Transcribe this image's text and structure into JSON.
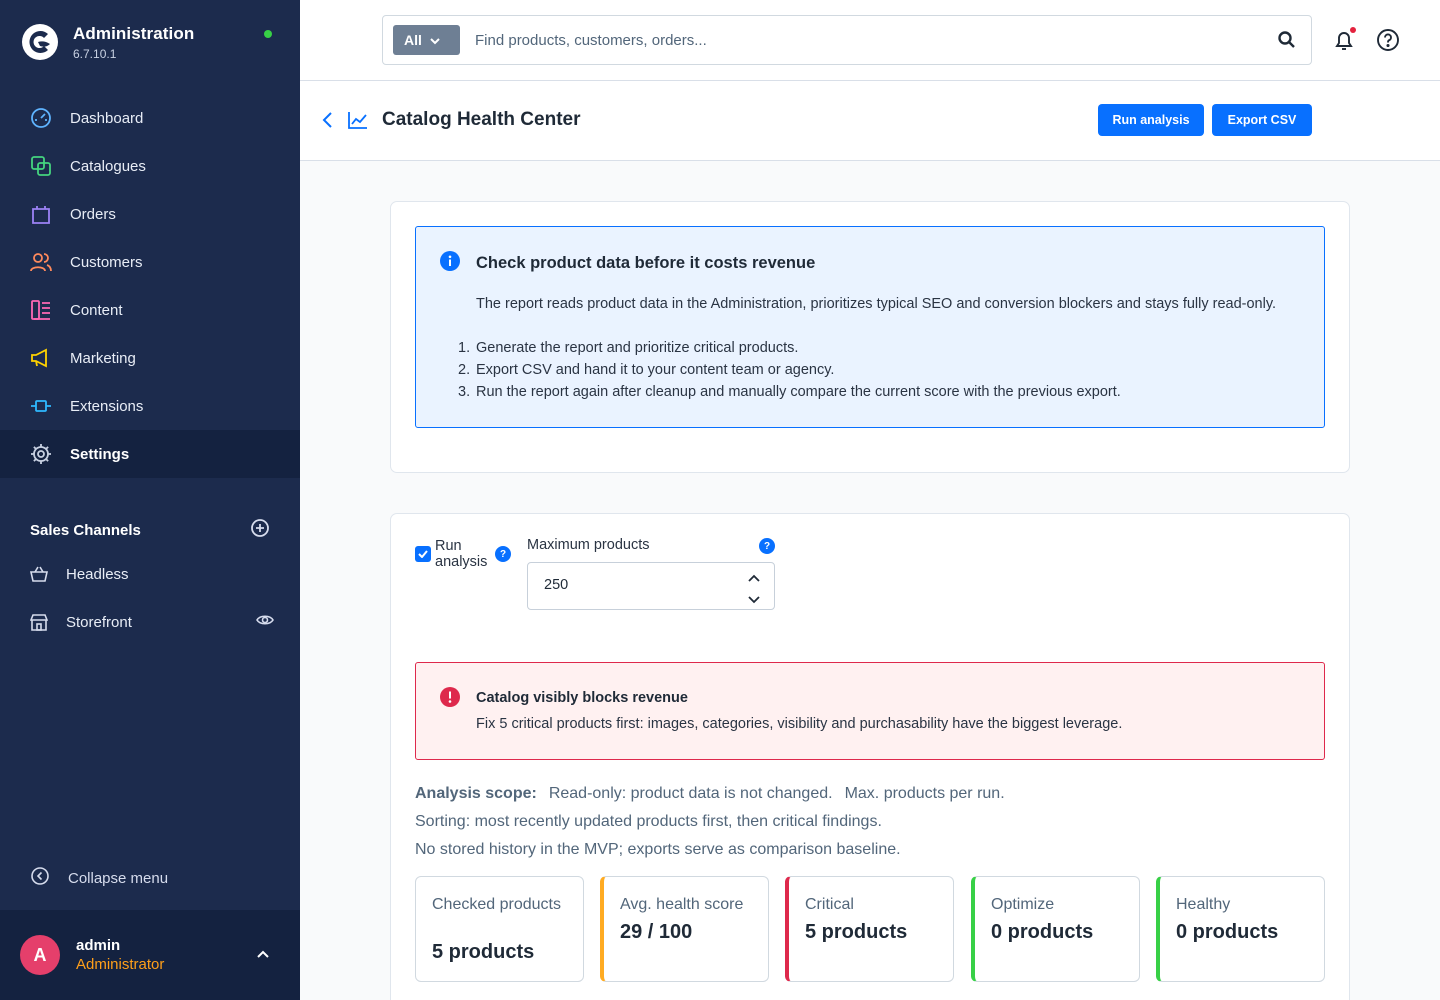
{
  "app": {
    "title": "Administration",
    "version": "6.7.10.1"
  },
  "sidebar": {
    "items": [
      {
        "label": "Dashboard",
        "icon": "dashboard-icon",
        "color": "#5fb4ff"
      },
      {
        "label": "Catalogues",
        "icon": "catalogue-icon",
        "color": "#44d37f"
      },
      {
        "label": "Orders",
        "icon": "shopping-bag-icon",
        "color": "#9c82f5"
      },
      {
        "label": "Customers",
        "icon": "users-icon",
        "color": "#ff8a5c"
      },
      {
        "label": "Content",
        "icon": "content-icon",
        "color": "#ff68b4"
      },
      {
        "label": "Marketing",
        "icon": "megaphone-icon",
        "color": "#ffd200"
      },
      {
        "label": "Extensions",
        "icon": "plug-icon",
        "color": "#2fb9ff"
      },
      {
        "label": "Settings",
        "icon": "gear-icon",
        "color": "#c9d2e3",
        "active": true
      }
    ],
    "sales_channels_title": "Sales Channels",
    "channels": [
      {
        "label": "Headless",
        "icon": "basket-icon"
      },
      {
        "label": "Storefront",
        "icon": "storefront-icon"
      }
    ],
    "collapse_label": "Collapse menu"
  },
  "user": {
    "initial": "A",
    "name": "admin",
    "role": "Administrator"
  },
  "search": {
    "type_label": "All",
    "placeholder": "Find products, customers, orders..."
  },
  "smartbar": {
    "title": "Catalog Health Center",
    "run_label": "Run analysis",
    "export_label": "Export CSV"
  },
  "info_alert": {
    "title": "Check product data before it costs revenue",
    "body": "The report reads product data in the Administration, prioritizes typical SEO and conversion blockers and stays fully read-only.",
    "steps": [
      "Generate the report and prioritize critical products.",
      "Export CSV and hand it to your content team or agency.",
      "Run the report again after cleanup and manually compare the current score with the previous export."
    ]
  },
  "settings": {
    "run_checkbox_label": "Run analysis",
    "run_checked": true,
    "max_products_label": "Maximum products",
    "max_products_value": "250",
    "help_glyph": "?"
  },
  "critical_alert": {
    "title": "Catalog visibly blocks revenue",
    "message": "Fix 5 critical products first: images, categories, visibility and purchasability have the biggest leverage."
  },
  "scope": {
    "label": "Analysis scope:",
    "line1a": "Read-only: product data is not changed.",
    "line1b": "Max. products per run.",
    "line2": "Sorting: most recently updated products first, then critical findings.",
    "line3": "No stored history in the MVP; exports serve as comparison baseline."
  },
  "kpis": [
    {
      "label": "Checked products",
      "value": "5 products",
      "accent": ""
    },
    {
      "label": "Avg. health score",
      "value": "29 / 100",
      "accent": "#ffab22"
    },
    {
      "label": "Critical",
      "value": "5 products",
      "accent": "#de294c"
    },
    {
      "label": "Optimize",
      "value": "0 products",
      "accent": "#37d046"
    },
    {
      "label": "Healthy",
      "value": "0 products",
      "accent": "#37d046"
    }
  ]
}
